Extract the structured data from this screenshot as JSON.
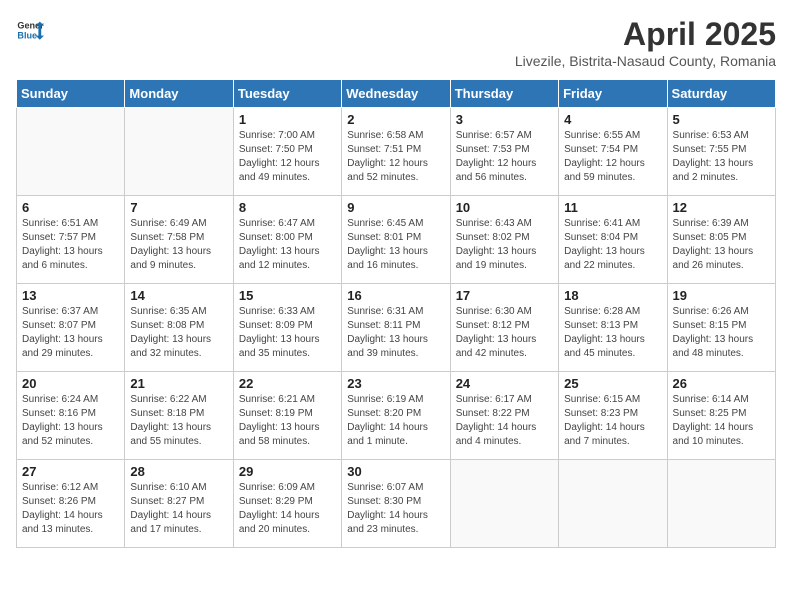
{
  "header": {
    "logo_general": "General",
    "logo_blue": "Blue",
    "title": "April 2025",
    "subtitle": "Livezile, Bistrita-Nasaud County, Romania"
  },
  "columns": [
    "Sunday",
    "Monday",
    "Tuesday",
    "Wednesday",
    "Thursday",
    "Friday",
    "Saturday"
  ],
  "weeks": [
    [
      {
        "day": "",
        "info": ""
      },
      {
        "day": "",
        "info": ""
      },
      {
        "day": "1",
        "info": "Sunrise: 7:00 AM\nSunset: 7:50 PM\nDaylight: 12 hours and 49 minutes."
      },
      {
        "day": "2",
        "info": "Sunrise: 6:58 AM\nSunset: 7:51 PM\nDaylight: 12 hours and 52 minutes."
      },
      {
        "day": "3",
        "info": "Sunrise: 6:57 AM\nSunset: 7:53 PM\nDaylight: 12 hours and 56 minutes."
      },
      {
        "day": "4",
        "info": "Sunrise: 6:55 AM\nSunset: 7:54 PM\nDaylight: 12 hours and 59 minutes."
      },
      {
        "day": "5",
        "info": "Sunrise: 6:53 AM\nSunset: 7:55 PM\nDaylight: 13 hours and 2 minutes."
      }
    ],
    [
      {
        "day": "6",
        "info": "Sunrise: 6:51 AM\nSunset: 7:57 PM\nDaylight: 13 hours and 6 minutes."
      },
      {
        "day": "7",
        "info": "Sunrise: 6:49 AM\nSunset: 7:58 PM\nDaylight: 13 hours and 9 minutes."
      },
      {
        "day": "8",
        "info": "Sunrise: 6:47 AM\nSunset: 8:00 PM\nDaylight: 13 hours and 12 minutes."
      },
      {
        "day": "9",
        "info": "Sunrise: 6:45 AM\nSunset: 8:01 PM\nDaylight: 13 hours and 16 minutes."
      },
      {
        "day": "10",
        "info": "Sunrise: 6:43 AM\nSunset: 8:02 PM\nDaylight: 13 hours and 19 minutes."
      },
      {
        "day": "11",
        "info": "Sunrise: 6:41 AM\nSunset: 8:04 PM\nDaylight: 13 hours and 22 minutes."
      },
      {
        "day": "12",
        "info": "Sunrise: 6:39 AM\nSunset: 8:05 PM\nDaylight: 13 hours and 26 minutes."
      }
    ],
    [
      {
        "day": "13",
        "info": "Sunrise: 6:37 AM\nSunset: 8:07 PM\nDaylight: 13 hours and 29 minutes."
      },
      {
        "day": "14",
        "info": "Sunrise: 6:35 AM\nSunset: 8:08 PM\nDaylight: 13 hours and 32 minutes."
      },
      {
        "day": "15",
        "info": "Sunrise: 6:33 AM\nSunset: 8:09 PM\nDaylight: 13 hours and 35 minutes."
      },
      {
        "day": "16",
        "info": "Sunrise: 6:31 AM\nSunset: 8:11 PM\nDaylight: 13 hours and 39 minutes."
      },
      {
        "day": "17",
        "info": "Sunrise: 6:30 AM\nSunset: 8:12 PM\nDaylight: 13 hours and 42 minutes."
      },
      {
        "day": "18",
        "info": "Sunrise: 6:28 AM\nSunset: 8:13 PM\nDaylight: 13 hours and 45 minutes."
      },
      {
        "day": "19",
        "info": "Sunrise: 6:26 AM\nSunset: 8:15 PM\nDaylight: 13 hours and 48 minutes."
      }
    ],
    [
      {
        "day": "20",
        "info": "Sunrise: 6:24 AM\nSunset: 8:16 PM\nDaylight: 13 hours and 52 minutes."
      },
      {
        "day": "21",
        "info": "Sunrise: 6:22 AM\nSunset: 8:18 PM\nDaylight: 13 hours and 55 minutes."
      },
      {
        "day": "22",
        "info": "Sunrise: 6:21 AM\nSunset: 8:19 PM\nDaylight: 13 hours and 58 minutes."
      },
      {
        "day": "23",
        "info": "Sunrise: 6:19 AM\nSunset: 8:20 PM\nDaylight: 14 hours and 1 minute."
      },
      {
        "day": "24",
        "info": "Sunrise: 6:17 AM\nSunset: 8:22 PM\nDaylight: 14 hours and 4 minutes."
      },
      {
        "day": "25",
        "info": "Sunrise: 6:15 AM\nSunset: 8:23 PM\nDaylight: 14 hours and 7 minutes."
      },
      {
        "day": "26",
        "info": "Sunrise: 6:14 AM\nSunset: 8:25 PM\nDaylight: 14 hours and 10 minutes."
      }
    ],
    [
      {
        "day": "27",
        "info": "Sunrise: 6:12 AM\nSunset: 8:26 PM\nDaylight: 14 hours and 13 minutes."
      },
      {
        "day": "28",
        "info": "Sunrise: 6:10 AM\nSunset: 8:27 PM\nDaylight: 14 hours and 17 minutes."
      },
      {
        "day": "29",
        "info": "Sunrise: 6:09 AM\nSunset: 8:29 PM\nDaylight: 14 hours and 20 minutes."
      },
      {
        "day": "30",
        "info": "Sunrise: 6:07 AM\nSunset: 8:30 PM\nDaylight: 14 hours and 23 minutes."
      },
      {
        "day": "",
        "info": ""
      },
      {
        "day": "",
        "info": ""
      },
      {
        "day": "",
        "info": ""
      }
    ]
  ]
}
